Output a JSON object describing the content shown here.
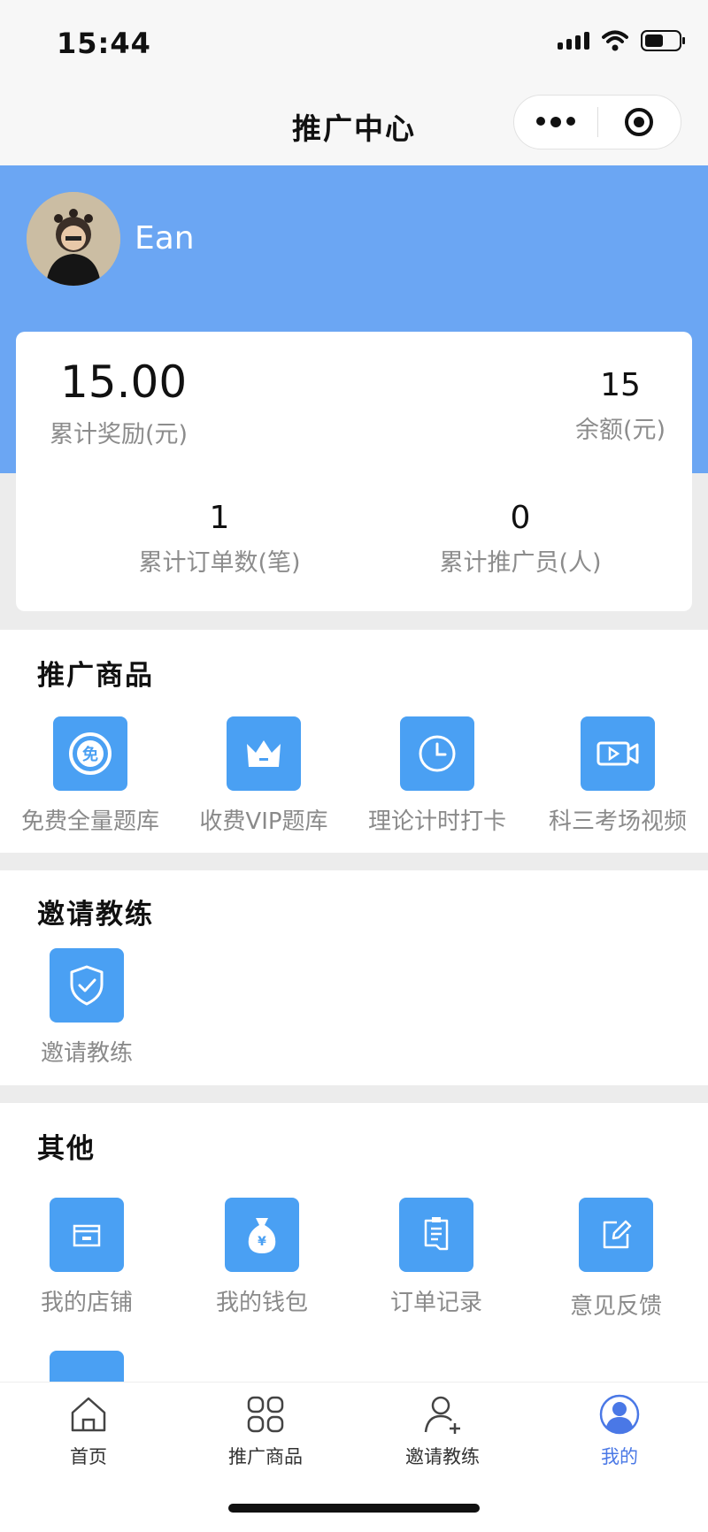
{
  "status_bar": {
    "time": "15:44"
  },
  "nav": {
    "title": "推广中心"
  },
  "profile": {
    "username": "Ean"
  },
  "stats": {
    "total_reward_value": "15.00",
    "total_reward_label": "累计奖励(元)",
    "balance_value": "15",
    "balance_label": "余额(元)",
    "orders_value": "1",
    "orders_label": "累计订单数(笔)",
    "promoters_value": "0",
    "promoters_label": "累计推广员(人)"
  },
  "products_section": {
    "title": "推广商品",
    "items": [
      {
        "label": "免费全量题库",
        "icon": "free-badge-icon"
      },
      {
        "label": "收费VIP题库",
        "icon": "crown-icon"
      },
      {
        "label": "理论计时打卡",
        "icon": "clock-icon"
      },
      {
        "label": "科三考场视频",
        "icon": "video-icon"
      }
    ]
  },
  "invite_section": {
    "title": "邀请教练",
    "items": [
      {
        "label": "邀请教练",
        "icon": "shield-check-icon"
      }
    ]
  },
  "other_section": {
    "title": "其他",
    "items": [
      {
        "label": "我的店铺",
        "icon": "store-icon"
      },
      {
        "label": "我的钱包",
        "icon": "money-bag-icon"
      },
      {
        "label": "订单记录",
        "icon": "order-list-icon"
      },
      {
        "label": "意见反馈",
        "icon": "edit-icon"
      }
    ]
  },
  "tabbar": {
    "items": [
      {
        "label": "首页",
        "icon": "home-icon"
      },
      {
        "label": "推广商品",
        "icon": "grid-icon"
      },
      {
        "label": "邀请教练",
        "icon": "add-user-icon"
      },
      {
        "label": "我的",
        "icon": "profile-icon"
      }
    ],
    "active_index": 3
  },
  "colors": {
    "header_blue": "#6ba6f3",
    "icon_blue": "#4aa0f3",
    "active_tab": "#4a78e6"
  }
}
